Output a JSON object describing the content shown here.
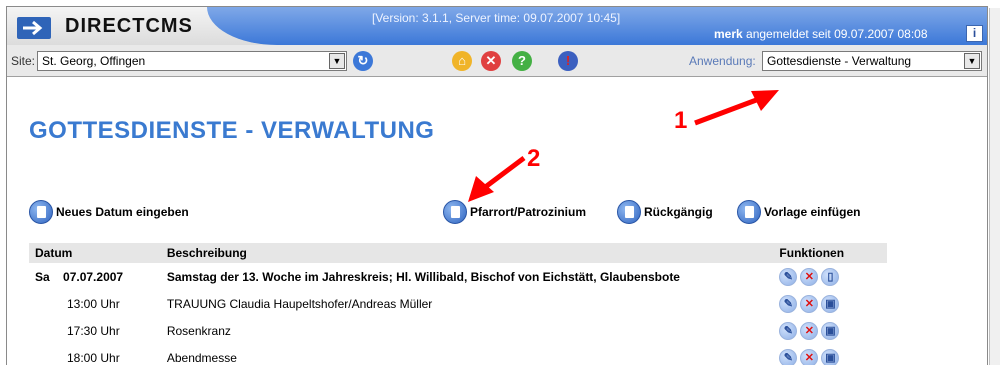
{
  "header": {
    "logo_text": "DIRECTCMS",
    "version": "[Version: 3.1.1, Server time: 09.07.2007 10:45]",
    "user_name": "merk",
    "user_status": "angemeldet seit 09.07.2007 08:08",
    "info_icon_label": "i"
  },
  "toolbar": {
    "site_label": "Site:",
    "site_value": "St. Georg, Offingen",
    "app_label": "Anwendung:",
    "app_value": "Gottesdienste - Verwaltung"
  },
  "page": {
    "title": "GOTTESDIENSTE - VERWALTUNG"
  },
  "actions": {
    "new_date": "Neues Datum eingeben",
    "pfarrort": "Pfarrort/Patrozinium",
    "undo": "Rückgängig",
    "template": "Vorlage einfügen"
  },
  "callouts": {
    "one": "1",
    "two": "2"
  },
  "table": {
    "headers": [
      "Datum",
      "Beschreibung",
      "Funktionen"
    ],
    "rows": [
      {
        "day": "Sa",
        "date": "07.07.2007",
        "desc": "Samstag der 13. Woche im Jahreskreis; Hl. Willibald, Bischof von Eichstätt, Glaubensbote"
      },
      {
        "time": "13:00 Uhr",
        "desc": "TRAUUNG Claudia Haupeltshofer/Andreas Müller"
      },
      {
        "time": "17:30 Uhr",
        "desc": "Rosenkranz"
      },
      {
        "time": "18:00 Uhr",
        "desc": "Abendmesse"
      }
    ]
  },
  "colors": {
    "title_blue": "#3a7ad0",
    "header_blue": "#3c78d8",
    "callout_red": "#ff0000"
  }
}
